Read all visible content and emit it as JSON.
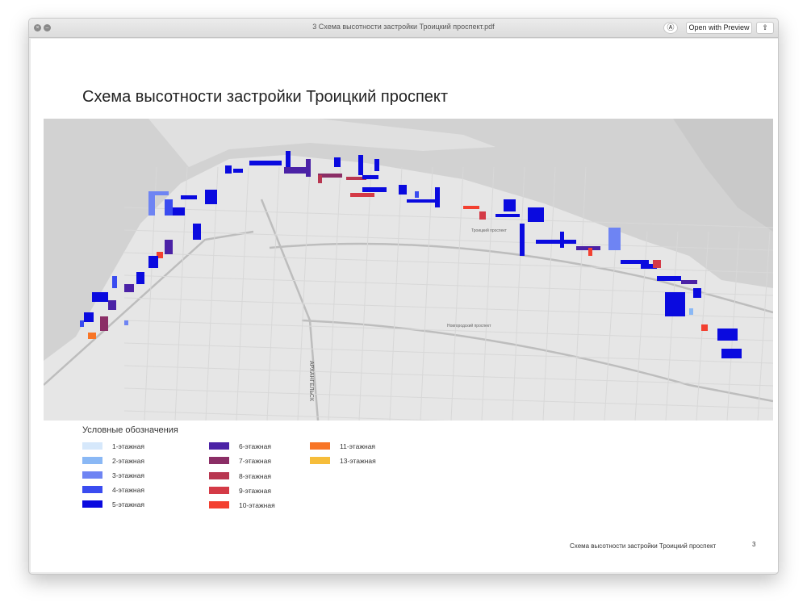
{
  "window": {
    "title": "3 Схема высотности застройки Троицкий проспект.pdf",
    "open_with_preview": "Open with Preview",
    "markup_icon": "pen-circle-icon",
    "share_icon": "share-icon",
    "close_icon": "close-icon",
    "minimize_icon": "minimize-icon"
  },
  "document": {
    "title": "Схема высотности застройки Троицкий проспект",
    "map": {
      "labels": {
        "city": "АРХАНГЕЛЬСК",
        "novgorodsky": "Новгородский проспект",
        "troitsky": "Троицкий проспект"
      }
    },
    "legend": {
      "heading": "Условные обозначения",
      "items": [
        {
          "label": "1-этажная",
          "color": "#d6e8fb"
        },
        {
          "label": "2-этажная",
          "color": "#8ab8f5"
        },
        {
          "label": "3-этажная",
          "color": "#6e84f3"
        },
        {
          "label": "4-этажная",
          "color": "#3a4cf0"
        },
        {
          "label": "5-этажная",
          "color": "#0a0adf"
        },
        {
          "label": "6-этажная",
          "color": "#4b22a6"
        },
        {
          "label": "7-этажная",
          "color": "#8b2e66"
        },
        {
          "label": "8-этажная",
          "color": "#b83650"
        },
        {
          "label": "9-этажная",
          "color": "#d43a46"
        },
        {
          "label": "10-этажная",
          "color": "#f34030"
        },
        {
          "label": "11-этажная",
          "color": "#f87526"
        },
        {
          "label": "13-этажная",
          "color": "#f6bd3a"
        }
      ]
    },
    "footer": {
      "text": "Схема высотности застройки Троицкий проспект",
      "page_number": "3"
    }
  }
}
